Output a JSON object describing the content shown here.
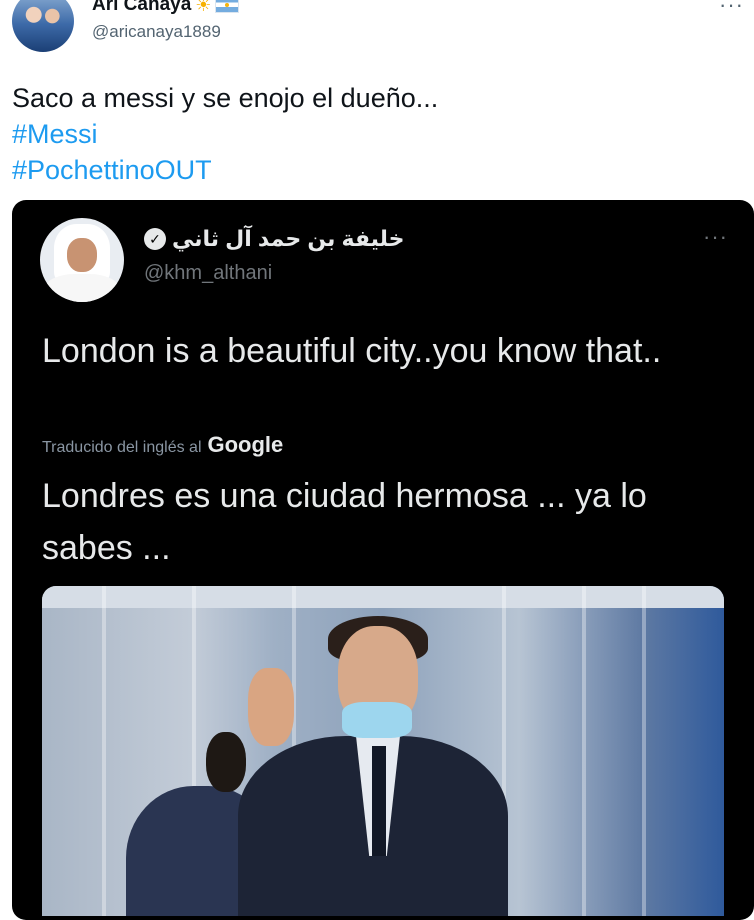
{
  "outer_tweet": {
    "name": "Ari Canaya",
    "name_emoji_1": "☀",
    "handle": "@aricanaya1889",
    "more": "···",
    "text": "Saco a messi y se enojo el dueño...",
    "hashtags": [
      "#Messi",
      "#PochettinoOUT"
    ]
  },
  "embedded_tweet": {
    "name": "خليفة بن حمد آل ثاني",
    "handle": "@khm_althani",
    "more": "···",
    "text": "London is a beautiful city..you know that..",
    "translated_label": "Traducido del inglés al",
    "translator": "Google",
    "translation": "Londres es una ciudad hermosa ... ya lo sabes ..."
  },
  "colors": {
    "link": "#1d9bf0",
    "card_bg": "#000000",
    "card_text": "#e7e9ea",
    "muted": "#536471"
  }
}
